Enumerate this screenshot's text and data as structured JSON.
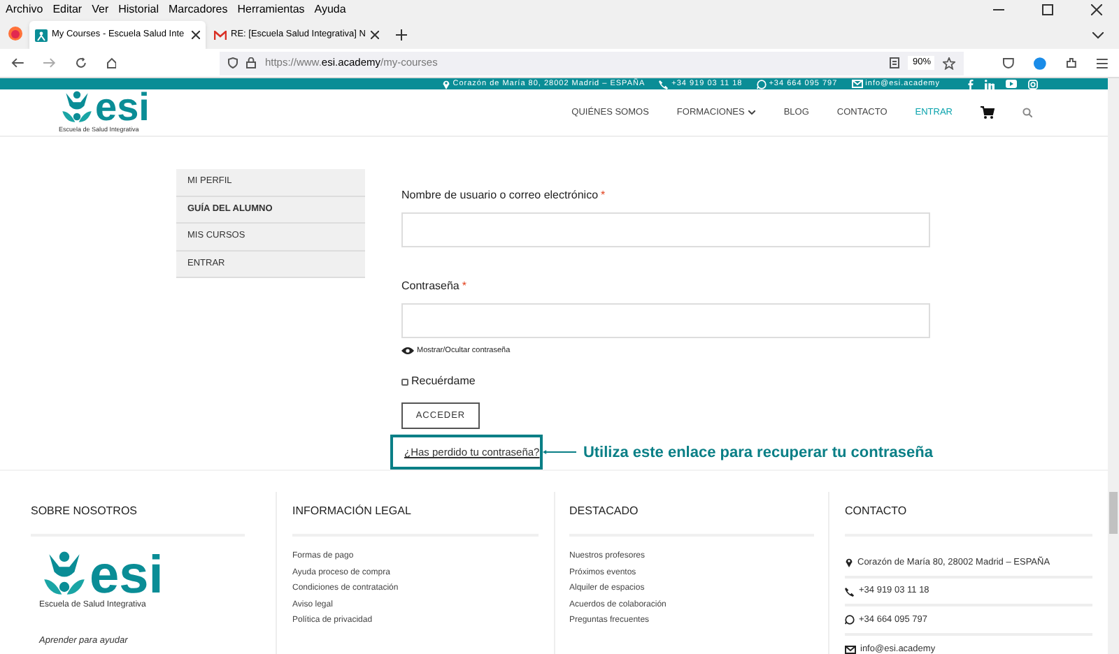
{
  "menu_bar": [
    "Archivo",
    "Editar",
    "Ver",
    "Historial",
    "Marcadores",
    "Herramientas",
    "Ayuda"
  ],
  "tabs": [
    {
      "title": "My Courses - Escuela Salud Inte",
      "selected": true,
      "kind": "site"
    },
    {
      "title": "RE: [Escuela Salud Integrativa] N",
      "selected": false,
      "kind": "mail"
    }
  ],
  "address_bar": {
    "url_prefix": "https://www.",
    "url_domain": "esi.academy",
    "url_path": "/my-courses",
    "zoom": "90%"
  },
  "top_bar": {
    "address": "Corazón de María 80, 28002 Madrid – ESPAÑA",
    "phone": "+34 919 03 11 18",
    "whatsapp": "+34 664 095 797",
    "email": "info@esi.academy"
  },
  "header": {
    "logo": "esi",
    "logo_subtitle": "Escuela de Salud Integrativa",
    "nav": [
      {
        "label": "QUIÉNES SOMOS",
        "selected": false,
        "dropdown": false
      },
      {
        "label": "FORMACIONES",
        "selected": false,
        "dropdown": true
      },
      {
        "label": "BLOG",
        "selected": false,
        "dropdown": false
      },
      {
        "label": "CONTACTO",
        "selected": false,
        "dropdown": false
      },
      {
        "label": "ENTRAR",
        "selected": true,
        "dropdown": false
      }
    ]
  },
  "account_menu": [
    {
      "label": "MI PERFIL",
      "selected": false
    },
    {
      "label": "GUÍA DEL ALUMNO",
      "selected": true
    },
    {
      "label": "MIS CURSOS",
      "selected": false
    },
    {
      "label": "ENTRAR",
      "selected": false
    }
  ],
  "login_form": {
    "username_label": "Nombre de usuario o correo electrónico",
    "username_required": "*",
    "password_label": "Contraseña",
    "password_required": "*",
    "show_password": "Mostrar/Ocultar contraseña",
    "remember": {
      "label": "Recuérdame",
      "checked": false
    },
    "submit": "ACCEDER",
    "lost_password": "¿Has perdido tu contraseña?",
    "annotation": "Utiliza este enlace para recuperar tu contraseña"
  },
  "footer": {
    "about": {
      "heading": "SOBRE NOSOTROS",
      "logo": "esi",
      "logo_subtitle": "Escuela de Salud Integrativa",
      "tagline": "Aprender para ayudar"
    },
    "legal": {
      "heading": "INFORMACIÓN LEGAL",
      "links": [
        "Formas de pago",
        "Ayuda proceso de compra",
        "Condiciones de contratación",
        "Aviso legal",
        "Política de privacidad"
      ]
    },
    "featured": {
      "heading": "DESTACADO",
      "links": [
        "Nuestros profesores",
        "Próximos eventos",
        "Alquiler de espacios",
        "Acuerdos de colaboración",
        "Preguntas frecuentes"
      ]
    },
    "contact": {
      "heading": "CONTACTO",
      "items": [
        {
          "kind": "address",
          "text": "Corazón de María 80, 28002 Madrid – ESPAÑA"
        },
        {
          "kind": "phone",
          "text": "+34 919 03 11 18"
        },
        {
          "kind": "whatsapp",
          "text": "+34 664 095 797"
        },
        {
          "kind": "email",
          "text": "info@esi.academy"
        }
      ]
    }
  }
}
